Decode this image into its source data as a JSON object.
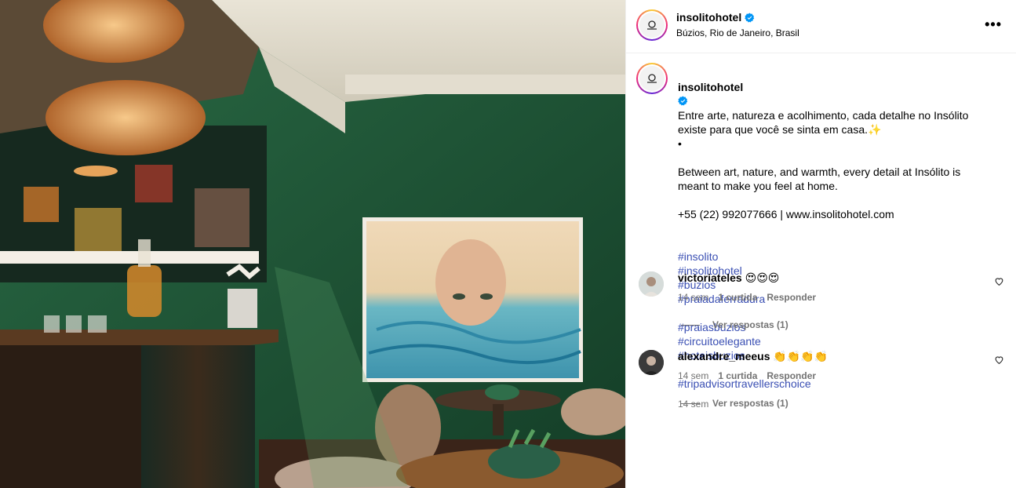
{
  "post": {
    "image_alt": "Hotel lounge with green walls, rattan pendant lamps and a painting of a woman in water"
  },
  "header": {
    "username": "insolitohotel",
    "location": "Búzios, Rio de Janeiro, Brasil",
    "more_label": "•••"
  },
  "caption": {
    "username": "insolitohotel",
    "text_pt": "Entre arte, natureza e acolhimento, cada detalhe no Insólito existe para que você se sinta em casa.✨",
    "bullet": "•",
    "text_en": "Between art, nature, and warmth, every detail at Insólito is meant to make you feel at home.",
    "contact": "+55 (22) 992077666 | www.insolitohotel.com",
    "hashtags": [
      "#insolito",
      "#insolitohotel",
      "#buzios",
      "#praiadaferradura",
      "#praiasbuzios",
      "#circuitoelegante",
      "#hoteisbuzios",
      "#tripadvisortravellerschoice"
    ],
    "time": "14 sem"
  },
  "comments": [
    {
      "username": "victoriateles",
      "text": "😍😍😍",
      "time": "14 sem",
      "likes": "1 curtida",
      "reply_label": "Responder",
      "view_replies": "Ver respostas (1)"
    },
    {
      "username": "alexandre_meeus",
      "text": "👏👏👏👏",
      "time": "14 sem",
      "likes": "1 curtida",
      "reply_label": "Responder",
      "view_replies": "Ver respostas (1)"
    }
  ],
  "colors": {
    "link": "#3a4fb3",
    "muted": "#737373",
    "verified": "#0095f6",
    "wall_green": "#1e5a3a"
  }
}
